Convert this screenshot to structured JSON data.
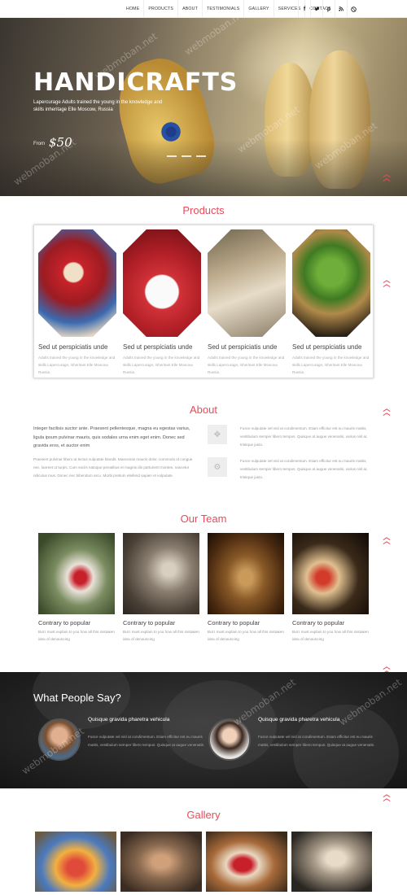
{
  "nav": {
    "links": [
      "HOME",
      "PRODUCTS",
      "ABOUT",
      "TESTIMONIALS",
      "GALLERY",
      "SERVICES",
      "CONTACT"
    ],
    "social": [
      "f",
      "t",
      "p",
      "rss",
      "d"
    ]
  },
  "hero": {
    "title": "HANDICRAFTS",
    "subtitle": "Lapercurage Adults trained the young in the knowledge and skills inheritage Elle Moscow, Russia",
    "price_label": "From",
    "price": "$50",
    "watermark": "webmoban.net"
  },
  "products": {
    "title": "Products",
    "items": [
      {
        "name": "Sed ut perspiciatis unde",
        "desc": "Adults trained the young in the knowledge and skills Lapercurage, inheritant Elle Moscow, Russia"
      },
      {
        "name": "Sed ut perspiciatis unde",
        "desc": "Adults trained the young in the knowledge and skills Lapercurage, inheritant Elle Moscow, Russia"
      },
      {
        "name": "Sed ut perspiciatis unde",
        "desc": "Adults trained the young in the knowledge and skills Lapercurage, inheritant Elle Moscow, Russia"
      },
      {
        "name": "Sed ut perspiciatis unde",
        "desc": "Adults trained the young in the knowledge and skills Lapercurage, inheritant Elle Moscow, Russia"
      }
    ]
  },
  "about": {
    "title": "About",
    "lead": "Integer facilisis auctor ante. Praesent pellentesque, magna eu egestas varius, ligula ipsum pulvinar mauris, quis sodales urna enim eget enim. Donec sed gravida eros, et auctor enim",
    "body": "Praesent pulvinar libero at lectus vulputate blandit. Maecenas mauris dolor, commodo id congue nec, laoreet ut turpis. Cum sociis natoque penatibus et magnis dis parturient montes, nascetur ridiculus mus. Donec nec bibendum arcu. Morbi pretium eleifend sapien et vulputate.",
    "features": [
      "Fusce vulputate vel nisl at condimentum. Etiam efficitur est eu mauris mattis, vestibulum semper libero tempus. Quisque at augue venenatis, varius nisl at, tristique justo.",
      "Fusce vulputate vel nisl at condimentum. Etiam efficitur est eu mauris mattis, vestibulum semper libero tempus. Quisque at augue venenatis, varius nisl at, tristique justo."
    ]
  },
  "team": {
    "title": "Our Team",
    "members": [
      {
        "name": "Contrary to popular",
        "desc": "But I must explain to you how all this mistaken idea of denouncing"
      },
      {
        "name": "Contrary to popular",
        "desc": "But I must explain to you how all this mistaken idea of denouncing"
      },
      {
        "name": "Contrary to popular",
        "desc": "But I must explain to you how all this mistaken idea of denouncing"
      },
      {
        "name": "Contrary to popular",
        "desc": "But I must explain to you how all this mistaken idea of denouncing"
      }
    ]
  },
  "testimonials": {
    "title": "What People Say?",
    "items": [
      {
        "title": "Quisque gravida pharetra vehicula",
        "text": "Fusce vulputate vel nisl at condimentum. Etiam efficitur est eu mauris mattis, vestibulum semper libero tempus. Quisque at augue venenatis."
      },
      {
        "title": "Quisque gravida pharetra vehicula",
        "text": "Fusce vulputate vel nisl at condimentum. Etiam efficitur est eu mauris mattis, vestibulum semper libero tempus. Quisque at augue venenatis."
      }
    ]
  },
  "gallery": {
    "title": "Gallery"
  },
  "colors": {
    "accent": "#e84b5a"
  },
  "icons": {
    "scroll_up": "double-chevron-up-icon",
    "about_feature_1": "puzzle-icon",
    "about_feature_2": "gear-icon"
  }
}
